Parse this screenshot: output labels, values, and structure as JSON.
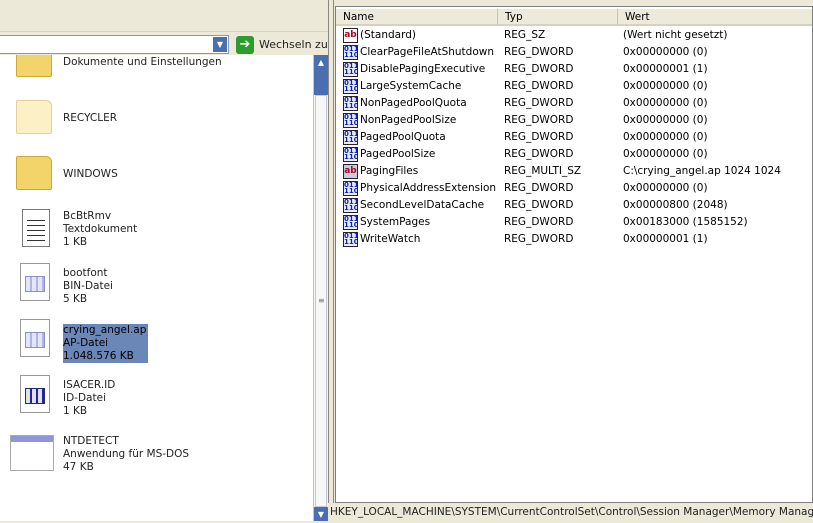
{
  "explorer": {
    "goto_label": "Wechseln zu",
    "items": [
      {
        "name": "Dokumente und Einstellungen",
        "icon": "folder-icon"
      },
      {
        "name": "RECYCLER",
        "icon": "folder-icon"
      },
      {
        "name": "WINDOWS",
        "icon": "folder-icon"
      },
      {
        "name": "BcBtRmv",
        "type": "Textdokument",
        "size": "1 KB",
        "icon": "text-document-icon"
      },
      {
        "name": "bootfont",
        "type": "BIN-Datei",
        "size": "5 KB",
        "icon": "file-icon"
      },
      {
        "name": "crying_angel.ap",
        "type": "AP-Datei",
        "size": "1.048.576 KB",
        "icon": "file-icon",
        "selected": true
      },
      {
        "name": "ISACER.ID",
        "type": "ID-Datei",
        "size": "1 KB",
        "icon": "file-icon"
      },
      {
        "name": "NTDETECT",
        "type": "Anwendung für MS-DOS",
        "size": "47 KB",
        "icon": "application-icon"
      }
    ]
  },
  "registry": {
    "columns": [
      "Name",
      "Typ",
      "Wert"
    ],
    "rows": [
      {
        "name": "(Standard)",
        "type": "REG_SZ",
        "value": "(Wert nicht gesetzt)",
        "icon": "ab"
      },
      {
        "name": "ClearPageFileAtShutdown",
        "type": "REG_DWORD",
        "value": "0x00000000 (0)",
        "icon": "bin"
      },
      {
        "name": "DisablePagingExecutive",
        "type": "REG_DWORD",
        "value": "0x00000001 (1)",
        "icon": "bin"
      },
      {
        "name": "LargeSystemCache",
        "type": "REG_DWORD",
        "value": "0x00000000 (0)",
        "icon": "bin"
      },
      {
        "name": "NonPagedPoolQuota",
        "type": "REG_DWORD",
        "value": "0x00000000 (0)",
        "icon": "bin"
      },
      {
        "name": "NonPagedPoolSize",
        "type": "REG_DWORD",
        "value": "0x00000000 (0)",
        "icon": "bin"
      },
      {
        "name": "PagedPoolQuota",
        "type": "REG_DWORD",
        "value": "0x00000000 (0)",
        "icon": "bin"
      },
      {
        "name": "PagedPoolSize",
        "type": "REG_DWORD",
        "value": "0x00000000 (0)",
        "icon": "bin"
      },
      {
        "name": "PagingFiles",
        "type": "REG_MULTI_SZ",
        "value": "C:\\crying_angel.ap 1024 1024",
        "icon": "ab-multi"
      },
      {
        "name": "PhysicalAddressExtension",
        "type": "REG_DWORD",
        "value": "0x00000000 (0)",
        "icon": "bin"
      },
      {
        "name": "SecondLevelDataCache",
        "type": "REG_DWORD",
        "value": "0x00000800 (2048)",
        "icon": "bin"
      },
      {
        "name": "SystemPages",
        "type": "REG_DWORD",
        "value": "0x00183000 (1585152)",
        "icon": "bin"
      },
      {
        "name": "WriteWatch",
        "type": "REG_DWORD",
        "value": "0x00000001 (1)",
        "icon": "bin"
      }
    ],
    "status_path": "HKEY_LOCAL_MACHINE\\SYSTEM\\CurrentControlSet\\Control\\Session Manager\\Memory Management"
  }
}
